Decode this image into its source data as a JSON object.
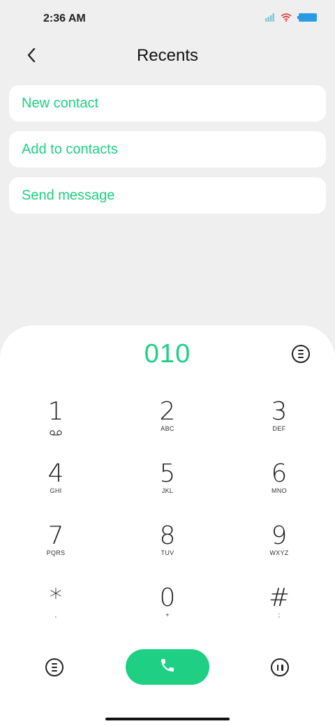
{
  "status_bar": {
    "time": "2:36 AM",
    "icons": [
      "signal-icon",
      "wifi-icon",
      "battery-icon"
    ]
  },
  "header": {
    "back_icon": "chevron-left-icon",
    "title": "Recents"
  },
  "options": [
    {
      "label": "New contact"
    },
    {
      "label": "Add to contacts"
    },
    {
      "label": "Send message"
    }
  ],
  "dialpad": {
    "dialed_number": "010",
    "menu_icon": "menu-circle-icon",
    "keys": [
      {
        "digit": "1",
        "letters": "",
        "icon": "voicemail-icon"
      },
      {
        "digit": "2",
        "letters": "ABC"
      },
      {
        "digit": "3",
        "letters": "DEF"
      },
      {
        "digit": "4",
        "letters": "GHI"
      },
      {
        "digit": "5",
        "letters": "JKL"
      },
      {
        "digit": "6",
        "letters": "MNO"
      },
      {
        "digit": "7",
        "letters": "PQRS"
      },
      {
        "digit": "8",
        "letters": "TUV"
      },
      {
        "digit": "9",
        "letters": "WXYZ"
      },
      {
        "digit": "*",
        "letters": ","
      },
      {
        "digit": "0",
        "letters": "+"
      },
      {
        "digit": "#",
        "letters": ";"
      }
    ],
    "bottom": {
      "left_icon": "menu-circle-icon",
      "call_icon": "phone-icon",
      "right_icon": "pause-circle-icon"
    }
  },
  "colors": {
    "accent": "#1fcf85",
    "background": "#efefef",
    "surface": "#ffffff",
    "text": "#222222"
  }
}
